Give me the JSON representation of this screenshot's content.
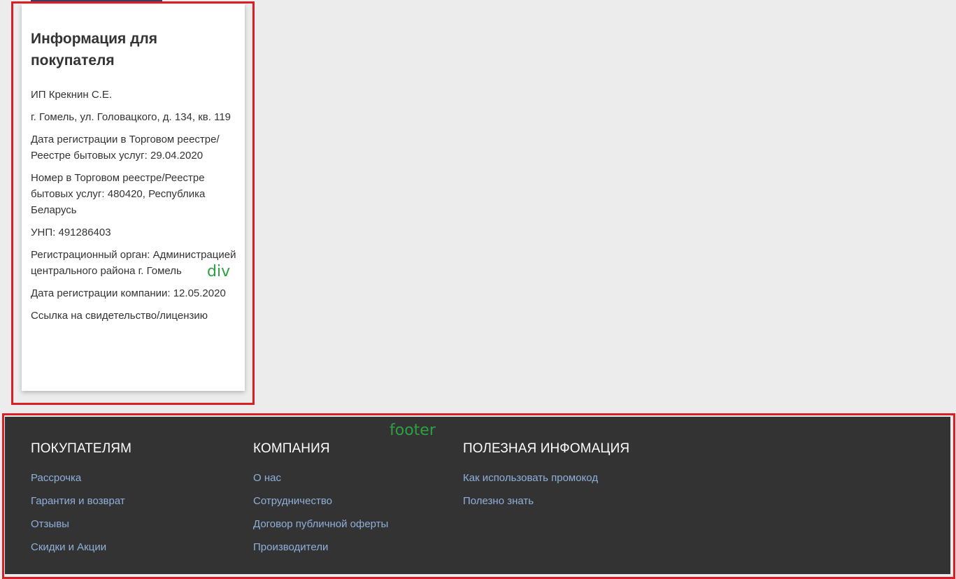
{
  "annotations": {
    "div_label": "div",
    "footer_label": "footer"
  },
  "buyer_info": {
    "title": "Информация для покупателя",
    "lines": [
      "ИП Крекнин С.Е.",
      "г. Гомель, ул. Головацкого, д. 134, кв. 119",
      "Дата регистрации в Торговом реестре/Реестре бытовых услуг: 29.04.2020",
      "Номер в Торговом реестре/Реестре бытовых услуг: 480420, Республика Беларусь",
      "УНП: 491286403",
      "Регистрационный орган: Администрацией центрального района г. Гомель",
      "Дата регистрации компании: 12.05.2020"
    ],
    "license_link": "Ссылка на свидетельство/лицензию"
  },
  "footer": {
    "columns": [
      {
        "heading": "ПОКУПАТЕЛЯМ",
        "links": [
          "Рассрочка",
          "Гарантия и возврат",
          "Отзывы",
          "Скидки и Акции"
        ]
      },
      {
        "heading": "КОМПАНИЯ",
        "links": [
          "О нас",
          "Сотрудничество",
          "Договор публичной оферты",
          "Производители"
        ]
      },
      {
        "heading": "ПОЛЕЗНАЯ ИНФОМАЦИЯ",
        "links": [
          "Как использовать промокод",
          "Полезно знать"
        ]
      }
    ]
  },
  "colors": {
    "background": "#ececec",
    "footer_background": "#333333",
    "footer_link": "#8fb0db",
    "annotation_box": "#d81f26",
    "annotation_text": "#2ea043"
  }
}
